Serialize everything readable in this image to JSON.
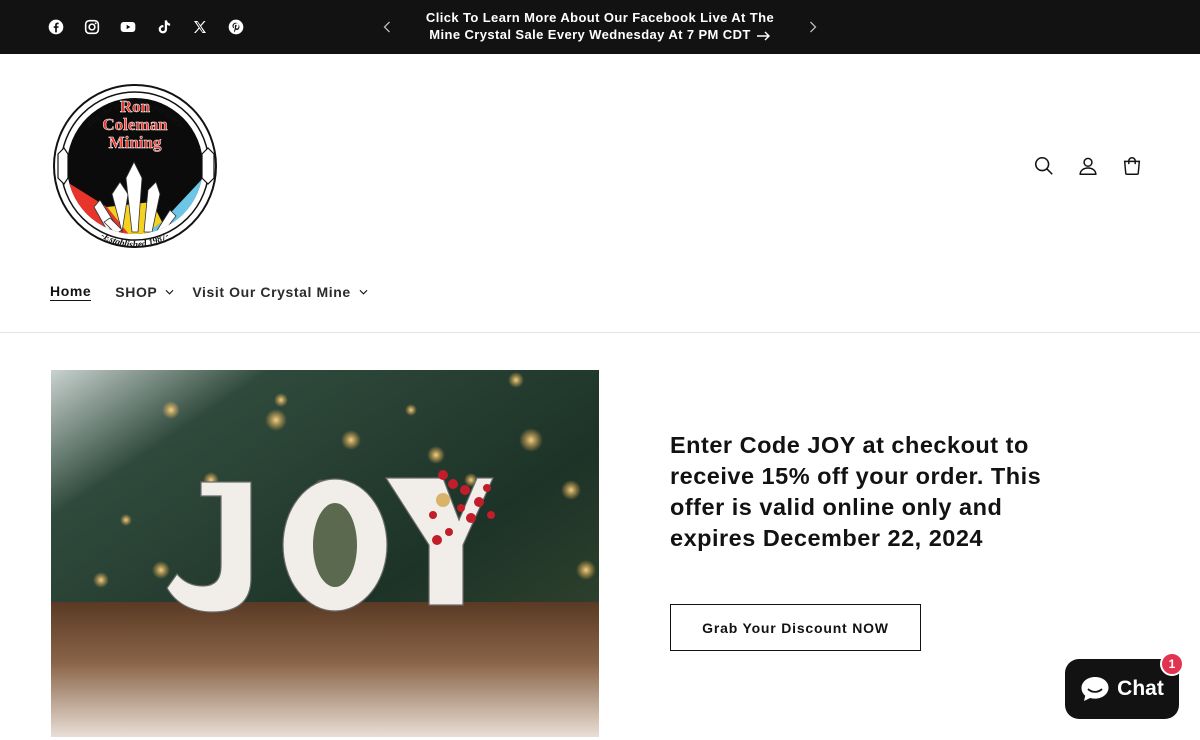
{
  "announcement": {
    "text_line1": "Click To Learn More About Our Facebook Live At The",
    "text_line2": "Mine Crystal Sale Every Wednesday At 7 PM CDT",
    "social_icons": [
      "facebook-icon",
      "instagram-icon",
      "youtube-icon",
      "tiktok-icon",
      "x-icon",
      "pinterest-icon"
    ]
  },
  "logo": {
    "top_arc": "-Dig the crystal experience-",
    "line1": "Ron",
    "line2": "Coleman",
    "line3": "Mining",
    "bottom_arc": "-Established 1987-"
  },
  "header": {
    "icons": [
      "search-icon",
      "account-icon",
      "cart-icon"
    ]
  },
  "nav": {
    "home": "Home",
    "shop": "SHOP",
    "visit": "Visit Our Crystal Mine"
  },
  "hero": {
    "image_word": "JOY",
    "heading": "Enter Code JOY at checkout to receive 15% off your order. This offer is valid online only and expires December 22, 2024",
    "button": "Grab Your Discount NOW"
  },
  "chat": {
    "label": "Chat",
    "badge": "1"
  },
  "colors": {
    "announcement_bg": "#121212",
    "text": "#121212",
    "chat_badge": "#e3344f",
    "logo_red": "#e8352b",
    "logo_yellow": "#f4d21f",
    "logo_blue": "#6cc6e8"
  }
}
